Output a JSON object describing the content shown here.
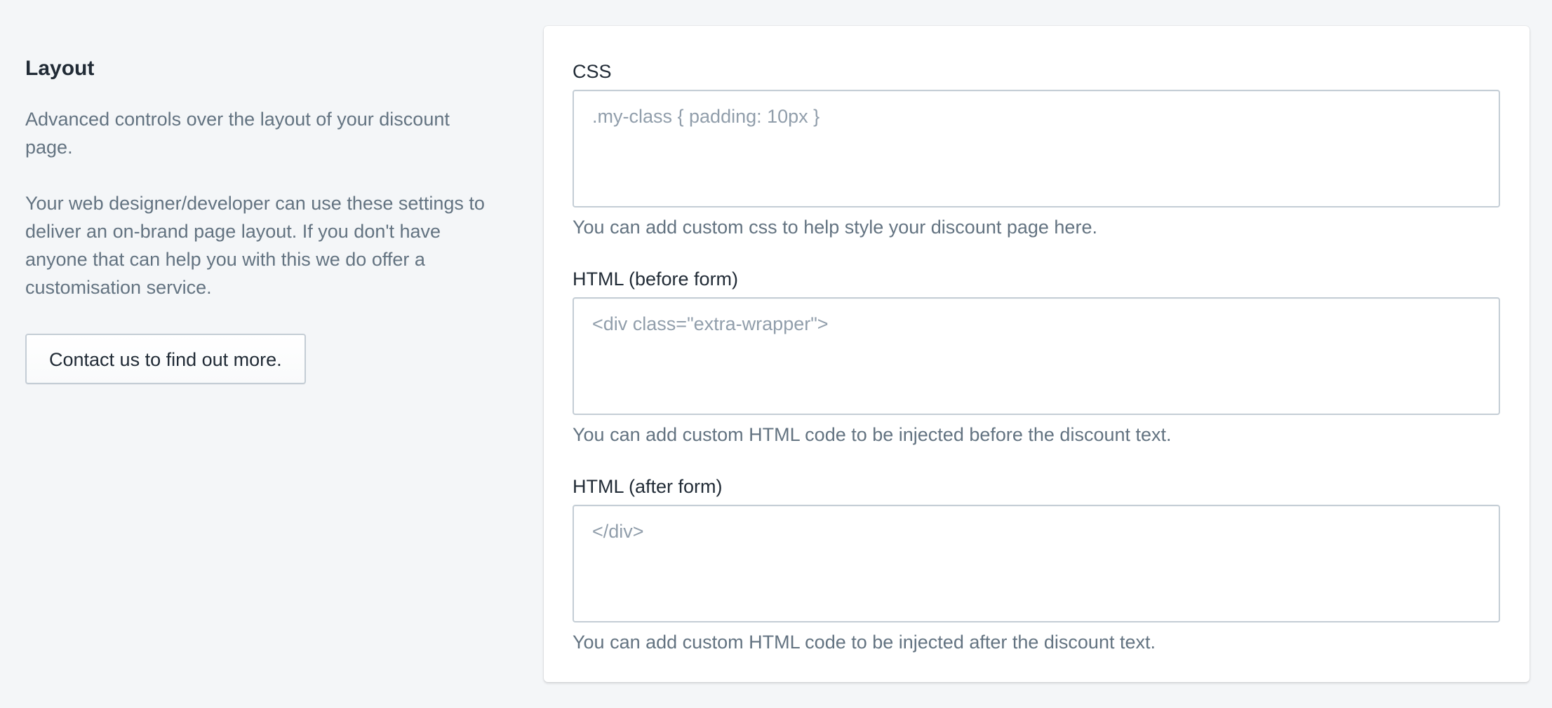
{
  "annotation": {
    "title": "Layout",
    "description": "Advanced controls over the layout of your discount page.",
    "details": "Your web designer/developer can use these settings to deliver an on-brand page layout. If you don't have anyone that can help you with this we do offer a customisation service.",
    "contact_button_label": "Contact us to find out more."
  },
  "fields": {
    "css": {
      "label": "CSS",
      "value": "",
      "placeholder": ".my-class { padding: 10px }",
      "help": "You can add custom css to help style your discount page here."
    },
    "html_before": {
      "label": "HTML (before form)",
      "value": "",
      "placeholder": "<div class=\"extra-wrapper\">",
      "help": "You can add custom HTML code to be injected before the discount text."
    },
    "html_after": {
      "label": "HTML (after form)",
      "value": "",
      "placeholder": "</div>",
      "help": "You can add custom HTML code to be injected after the discount text."
    }
  },
  "colors": {
    "page_background": "#f4f6f8",
    "card_background": "#ffffff",
    "text_primary": "#212b36",
    "text_subdued": "#637381",
    "placeholder": "#919eab",
    "border": "#c4cdd5"
  }
}
